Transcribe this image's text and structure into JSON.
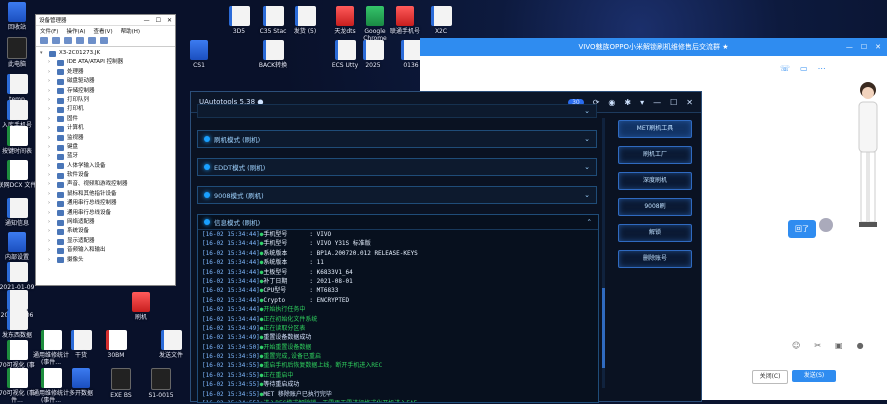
{
  "desktop": {
    "icons": [
      {
        "label": "回收站",
        "type": "app"
      },
      {
        "label": "此电脑",
        "type": "dark"
      },
      {
        "label": "temp",
        "type": "doc"
      },
      {
        "label": "入库手机号",
        "type": "doc"
      },
      {
        "label": "按键时间表",
        "type": "xls"
      },
      {
        "label": "联网DCX 文件",
        "type": "xls"
      },
      {
        "label": "通知信息",
        "type": "doc"
      },
      {
        "label": "内部设置",
        "type": "app"
      },
      {
        "label": "2021-01-09",
        "type": "doc"
      },
      {
        "label": "2021-0306",
        "type": "doc"
      },
      {
        "label": "发东西数据",
        "type": "doc"
      },
      {
        "label": "70可视化 (事件...",
        "type": "xls"
      },
      {
        "label": "70可视化 (事件...",
        "type": "xls"
      },
      {
        "label": "通用维修统计 (事件...",
        "type": "xls"
      },
      {
        "label": "通用维修统计 (事件...",
        "type": "xls"
      },
      {
        "label": "干货",
        "type": "doc"
      },
      {
        "label": "多开数据",
        "type": "app"
      },
      {
        "label": "30BM",
        "type": "pdf"
      },
      {
        "label": "EXE BS",
        "type": "dark"
      },
      {
        "label": "刷机",
        "type": "red"
      },
      {
        "label": "S1-0015",
        "type": "dark"
      },
      {
        "label": "发送文件",
        "type": "doc"
      },
      {
        "label": "3D5",
        "type": "doc"
      },
      {
        "label": "C35 Stac",
        "type": "doc"
      },
      {
        "label": "发货 (5)",
        "type": "doc"
      },
      {
        "label": "天龙dts",
        "type": "red"
      },
      {
        "label": "Google Chrome",
        "type": "grn"
      },
      {
        "label": "联通手机号",
        "type": "red"
      },
      {
        "label": "X2C",
        "type": "doc"
      },
      {
        "label": "CS1",
        "type": "app"
      },
      {
        "label": "BACK转换",
        "type": "doc"
      },
      {
        "label": "ECS Utty",
        "type": "doc"
      },
      {
        "label": "2025",
        "type": "doc"
      },
      {
        "label": "0136",
        "type": "doc"
      }
    ]
  },
  "device_manager": {
    "title": "设备管理器",
    "menu": [
      "文件(F)",
      "操作(A)",
      "查看(V)",
      "帮助(H)"
    ],
    "root": "X3-2C01273.JK",
    "items": [
      "IDE ATA/ATAPI 控制器",
      "处理器",
      "磁盘驱动器",
      "存储控制器",
      "打印队列",
      "打印机",
      "固件",
      "计算机",
      "监视器",
      "键盘",
      "蓝牙",
      "人体学输入设备",
      "软件设备",
      "声音、视频和游戏控制器",
      "鼠标和其他指针设备",
      "通用串行总线控制器",
      "通用串行总线设备",
      "网络适配器",
      "系统设备",
      "显示适配器",
      "音频输入和输出",
      "摄像头"
    ]
  },
  "chat": {
    "title": "VIVO魅族OPPO小米解锁刷机维修售后交流群 ★",
    "bubble_text": "回了",
    "close_label": "关闭(C)",
    "send_label": "发送(S)",
    "colors": {
      "accent": "#2f8cf0"
    }
  },
  "tool": {
    "title": "UAutotools 5.38 ●",
    "badge": "30",
    "sections": [
      {
        "label": "刷机模式 (刷机)"
      },
      {
        "label": "EDDT模式 (刷机)"
      },
      {
        "label": "9008模式 (刷机)"
      }
    ],
    "log_header": "信息模式 (刷机)",
    "log": [
      {
        "ts": "[16-02 15:34:44]",
        "key": "手机型号",
        "val": ":  VIVO",
        "kind": "kv"
      },
      {
        "ts": "[16-02 15:34:44]",
        "key": "手机型号",
        "val": ":  VIVO Y31S 标准版",
        "kind": "kv"
      },
      {
        "ts": "[16-02 15:34:44]",
        "key": "系统版本",
        "val": ":  BP1A.200720.012 RELEASE-KEYS",
        "kind": "kv"
      },
      {
        "ts": "[16-02 15:34:44]",
        "key": "系统版本",
        "val": ":  11",
        "kind": "kv"
      },
      {
        "ts": "[16-02 15:34:44]",
        "key": "主板型号",
        "val": ":  K6833V1_64",
        "kind": "kv"
      },
      {
        "ts": "[16-02 15:34:44]",
        "key": "补丁日期",
        "val": ":  2021-08-01",
        "kind": "kv"
      },
      {
        "ts": "[16-02 15:34:44]",
        "key": "CPU型号",
        "val": ":  MT6833",
        "kind": "kv"
      },
      {
        "ts": "[16-02 15:34:44]",
        "key": "Crypto",
        "val": ":  ENCRYPTED",
        "kind": "kv"
      },
      {
        "ts": "[16-02 15:34:44]",
        "msg": "开始执行任务中",
        "kind": "ok"
      },
      {
        "ts": "[16-02 15:34:44]",
        "msg": "正在初始化文件系统",
        "kind": "ok"
      },
      {
        "ts": "[16-02 15:34:49]",
        "msg": "正在读取分区表",
        "kind": "ok"
      },
      {
        "ts": "[16-02 15:34:49]",
        "msg": "重置设备数据成功",
        "kind": "info"
      },
      {
        "ts": "[16-02 15:34:50]",
        "msg": "开始重置设备数据",
        "kind": "ok"
      },
      {
        "ts": "[16-02 15:34:50]",
        "msg": "重置完成,设备已重启",
        "kind": "ok"
      },
      {
        "ts": "[16-02 15:34:55]",
        "msg": "重启手机后恢复数据上线，断开手机进入REC",
        "kind": "ok"
      },
      {
        "ts": "[16-02 15:34:55]",
        "msg": "正在重启中",
        "kind": "ok"
      },
      {
        "ts": "[16-02 15:34:55]",
        "msg": "等待重启成功",
        "kind": "info"
      },
      {
        "ts": "[16-02 15:34:55]",
        "msg": "MET 移除账户已执行完毕",
        "kind": "info"
      },
      {
        "ts": "[16-02 15:34:55]",
        "msg": "进入REC模式解除锁，无需再无需进行格式化开机进入FAE",
        "kind": "ok"
      },
      {
        "ts": "[16-02 15:34:55]",
        "msg": "",
        "kind": "info"
      }
    ],
    "right_buttons": [
      "MET刷机工具",
      "刷机工厂",
      "深度刷机",
      "9008刷",
      "解锁",
      "删除账号"
    ],
    "colors": {
      "glow": "#19a0ff",
      "ok": "#2fd15e"
    }
  }
}
